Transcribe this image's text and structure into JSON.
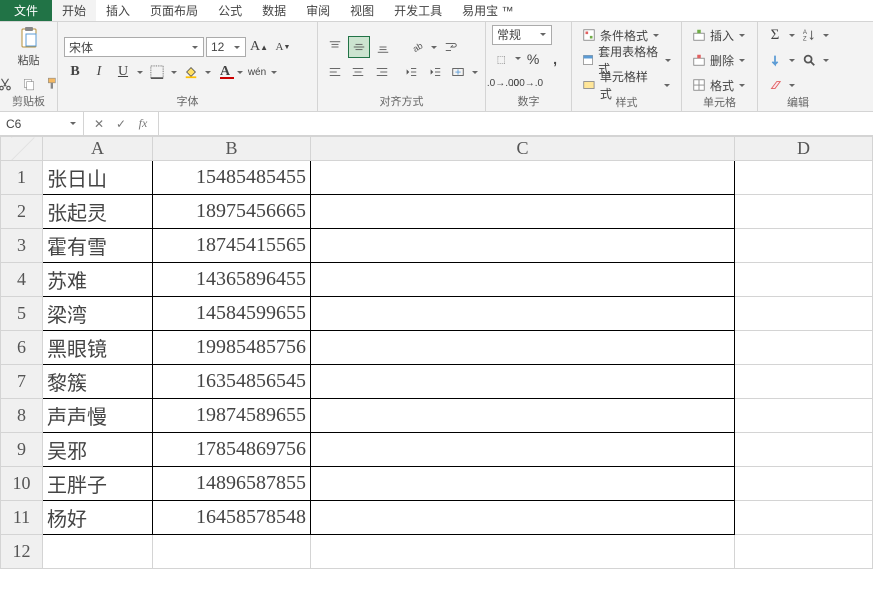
{
  "tabs": {
    "file": "文件",
    "home": "开始",
    "insert": "插入",
    "layout": "页面布局",
    "formulas": "公式",
    "data": "数据",
    "review": "审阅",
    "view": "视图",
    "dev": "开发工具",
    "addin": "易用宝 ™"
  },
  "groups": {
    "clipboard": "剪贴板",
    "font": "字体",
    "align": "对齐方式",
    "number": "数字",
    "styles": "样式",
    "cells": "单元格",
    "editing": "编辑"
  },
  "clipboard": {
    "paste": "粘贴"
  },
  "font": {
    "name": "宋体",
    "size": "12",
    "bold": "B",
    "italic": "I",
    "underline": "U",
    "wen": "wén"
  },
  "number": {
    "fmt": "常规",
    "pct": "%",
    "comma": ","
  },
  "styles": {
    "condfmt": "条件格式",
    "tablefmt": "套用表格格式",
    "cellstyle": "单元格样式"
  },
  "cells": {
    "insert": "插入",
    "delete": "删除",
    "format": "格式"
  },
  "namebox": "C6",
  "fxlabel": "fx",
  "formula": "",
  "cols": [
    "A",
    "B",
    "C",
    "D"
  ],
  "rows": [
    {
      "n": "1",
      "a": "张日山",
      "b": "15485485455"
    },
    {
      "n": "2",
      "a": "张起灵",
      "b": "18975456665"
    },
    {
      "n": "3",
      "a": "霍有雪",
      "b": "18745415565"
    },
    {
      "n": "4",
      "a": "苏难",
      "b": "14365896455"
    },
    {
      "n": "5",
      "a": "梁湾",
      "b": "14584599655"
    },
    {
      "n": "6",
      "a": "黑眼镜",
      "b": "19985485756"
    },
    {
      "n": "7",
      "a": "黎簇",
      "b": "16354856545"
    },
    {
      "n": "8",
      "a": "声声慢",
      "b": "19874589655"
    },
    {
      "n": "9",
      "a": "吴邪",
      "b": "17854869756"
    },
    {
      "n": "10",
      "a": "王胖子",
      "b": "14896587855"
    },
    {
      "n": "11",
      "a": "杨好",
      "b": "16458578548"
    },
    {
      "n": "12",
      "a": "",
      "b": ""
    }
  ]
}
